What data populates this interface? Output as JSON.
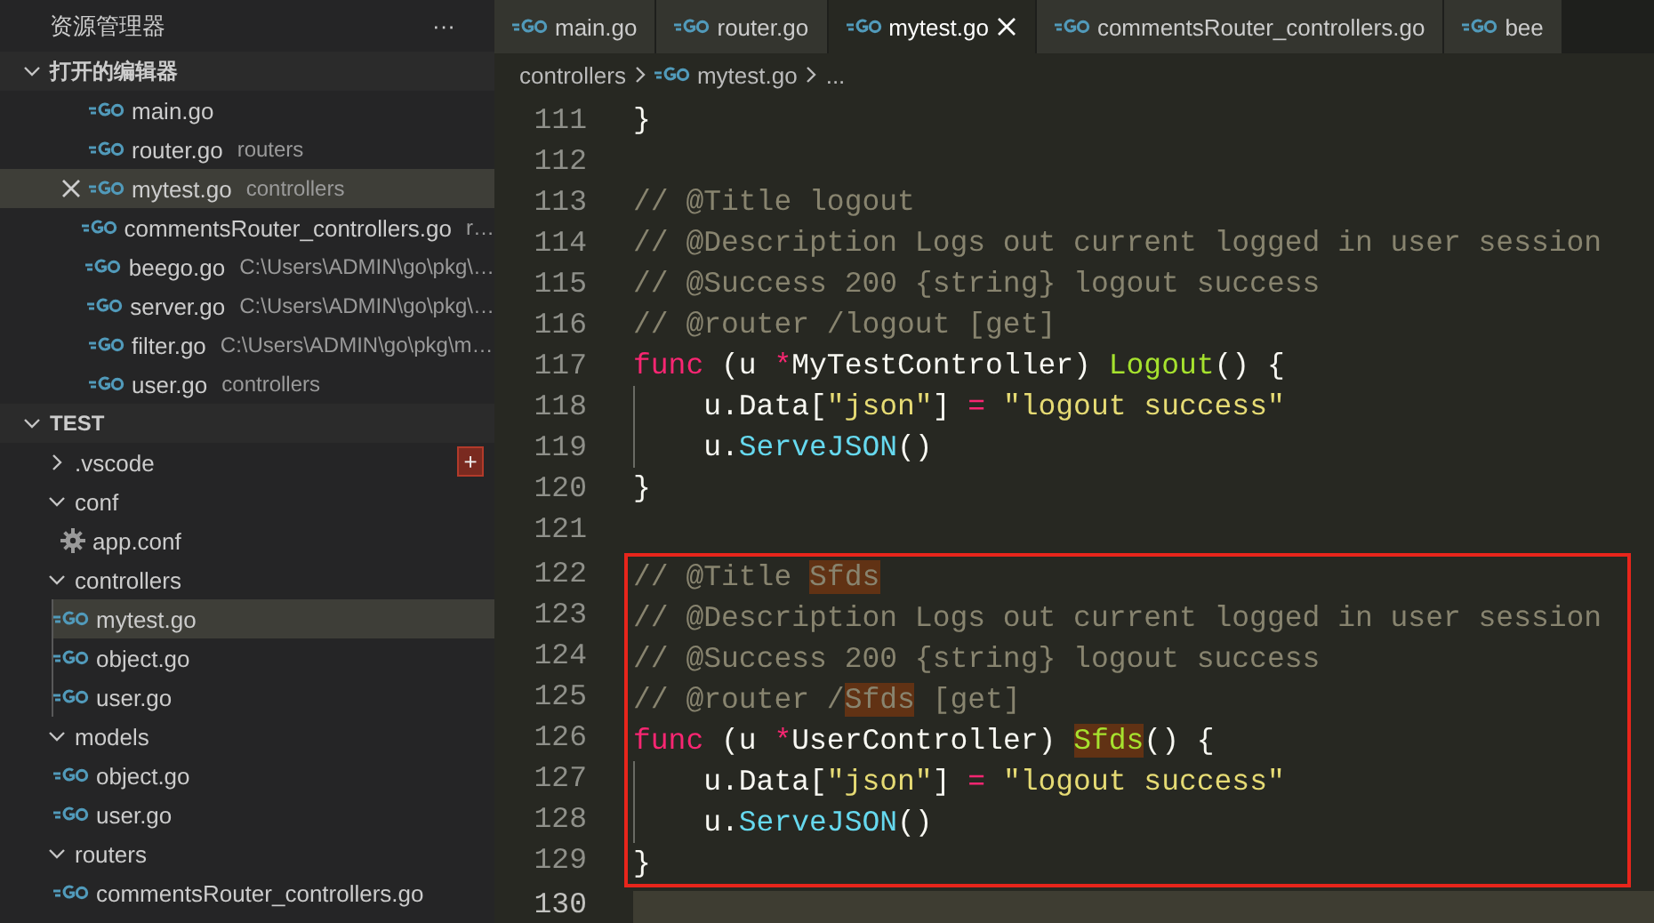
{
  "sidebar": {
    "title": "资源管理器",
    "more": "···",
    "open_editors": {
      "title": "打开的编辑器",
      "expanded": true,
      "items": [
        {
          "name": "main.go",
          "selected": false
        },
        {
          "name": "router.go",
          "detail": "routers",
          "selected": false
        },
        {
          "name": "mytest.go",
          "detail": "controllers",
          "selected": true
        },
        {
          "name": "commentsRouter_controllers.go",
          "detail": "r…",
          "selected": false
        },
        {
          "name": "beego.go",
          "detail": "C:\\Users\\ADMIN\\go\\pkg\\…",
          "selected": false
        },
        {
          "name": "server.go",
          "detail": "C:\\Users\\ADMIN\\go\\pkg\\…",
          "selected": false
        },
        {
          "name": "filter.go",
          "detail": "C:\\Users\\ADMIN\\go\\pkg\\m…",
          "selected": false
        },
        {
          "name": "user.go",
          "detail": "controllers",
          "selected": false
        }
      ]
    },
    "explorer": {
      "title": "TEST",
      "expanded": true,
      "children": [
        {
          "name": ".vscode",
          "kind": "folder",
          "expanded": false,
          "selected": false,
          "action_button": "+"
        },
        {
          "name": "conf",
          "kind": "folder",
          "expanded": true,
          "selected": false,
          "children": [
            {
              "name": "app.conf",
              "kind": "config-file",
              "selected": false
            }
          ]
        },
        {
          "name": "controllers",
          "kind": "folder",
          "expanded": true,
          "selected": false,
          "children": [
            {
              "name": "mytest.go",
              "kind": "go-file",
              "selected": true
            },
            {
              "name": "object.go",
              "kind": "go-file",
              "selected": false
            },
            {
              "name": "user.go",
              "kind": "go-file",
              "selected": false
            }
          ]
        },
        {
          "name": "models",
          "kind": "folder",
          "expanded": true,
          "selected": false,
          "children": [
            {
              "name": "object.go",
              "kind": "go-file",
              "selected": false
            },
            {
              "name": "user.go",
              "kind": "go-file",
              "selected": false
            }
          ]
        },
        {
          "name": "routers",
          "kind": "folder",
          "expanded": true,
          "selected": false,
          "children": [
            {
              "name": "commentsRouter_controllers.go",
              "kind": "go-file",
              "selected": false
            }
          ]
        }
      ]
    }
  },
  "tabs": [
    {
      "label": "main.go",
      "selected": false
    },
    {
      "label": "router.go",
      "selected": false
    },
    {
      "label": "mytest.go",
      "selected": true
    },
    {
      "label": "commentsRouter_controllers.go",
      "selected": false
    },
    {
      "label": "bee",
      "selected": false
    }
  ],
  "breadcrumbs": [
    {
      "kind": "folder",
      "text": "controllers"
    },
    {
      "kind": "go-file",
      "text": "mytest.go"
    },
    {
      "kind": "more",
      "text": "..."
    }
  ],
  "editor": {
    "blocks": [
      {
        "boxed": false,
        "lines": [
          {
            "number": "111",
            "current": false,
            "indent": false,
            "tokens": [
              {
                "text": "}",
                "kind": "plain",
                "match": false
              }
            ]
          },
          {
            "number": "112",
            "current": false,
            "indent": false
          },
          {
            "number": "113",
            "current": false,
            "indent": false,
            "tokens": [
              {
                "text": "// @Title logout",
                "kind": "comment",
                "match": false
              }
            ]
          },
          {
            "number": "114",
            "current": false,
            "indent": false,
            "tokens": [
              {
                "text": "// @Description Logs out current logged in user session",
                "kind": "comment",
                "match": false
              }
            ]
          },
          {
            "number": "115",
            "current": false,
            "indent": false,
            "tokens": [
              {
                "text": "// @Success 200 {string} logout success",
                "kind": "comment",
                "match": false
              }
            ]
          },
          {
            "number": "116",
            "current": false,
            "indent": false,
            "tokens": [
              {
                "text": "// @router /logout [get]",
                "kind": "comment",
                "match": false
              }
            ]
          },
          {
            "number": "117",
            "current": false,
            "indent": false,
            "tokens": [
              {
                "text": "func",
                "kind": "keyword",
                "match": false
              },
              {
                "text": " (u ",
                "kind": "plain",
                "match": false
              },
              {
                "text": "*",
                "kind": "operator",
                "match": false
              },
              {
                "text": "MyTestController) ",
                "kind": "plain",
                "match": false
              },
              {
                "text": "Logout",
                "kind": "function",
                "match": false
              },
              {
                "text": "() {",
                "kind": "plain",
                "match": false
              }
            ]
          },
          {
            "number": "118",
            "current": false,
            "indent": true,
            "tokens": [
              {
                "text": "u.Data[",
                "kind": "plain",
                "match": false
              },
              {
                "text": "\"json\"",
                "kind": "string",
                "match": false
              },
              {
                "text": "] ",
                "kind": "plain",
                "match": false
              },
              {
                "text": "=",
                "kind": "operator",
                "match": false
              },
              {
                "text": " \"logout success\"",
                "kind": "string",
                "match": false
              }
            ]
          },
          {
            "number": "119",
            "current": false,
            "indent": true,
            "tokens": [
              {
                "text": "u.",
                "kind": "plain",
                "match": false
              },
              {
                "text": "ServeJSON",
                "kind": "method",
                "match": false
              },
              {
                "text": "()",
                "kind": "plain",
                "match": false
              }
            ]
          },
          {
            "number": "120",
            "current": false,
            "indent": false,
            "tokens": [
              {
                "text": "}",
                "kind": "plain",
                "match": false
              }
            ]
          },
          {
            "number": "121",
            "current": false,
            "indent": false
          }
        ]
      },
      {
        "boxed": true,
        "lines": [
          {
            "number": "122",
            "current": false,
            "indent": false,
            "tokens": [
              {
                "text": "// @Title ",
                "kind": "comment",
                "match": false
              },
              {
                "text": "Sfds",
                "kind": "comment",
                "match": true
              }
            ]
          },
          {
            "number": "123",
            "current": false,
            "indent": false,
            "tokens": [
              {
                "text": "// @Description Logs out current logged in user session",
                "kind": "comment",
                "match": false
              }
            ]
          },
          {
            "number": "124",
            "current": false,
            "indent": false,
            "tokens": [
              {
                "text": "// @Success 200 {string} logout success",
                "kind": "comment",
                "match": false
              }
            ]
          },
          {
            "number": "125",
            "current": false,
            "indent": false,
            "tokens": [
              {
                "text": "// @router /",
                "kind": "comment",
                "match": false
              },
              {
                "text": "Sfds",
                "kind": "comment",
                "match": true
              },
              {
                "text": " [get]",
                "kind": "comment",
                "match": false
              }
            ]
          },
          {
            "number": "126",
            "current": false,
            "indent": false,
            "tokens": [
              {
                "text": "func",
                "kind": "keyword",
                "match": false
              },
              {
                "text": " (u ",
                "kind": "plain",
                "match": false
              },
              {
                "text": "*",
                "kind": "operator",
                "match": false
              },
              {
                "text": "UserController) ",
                "kind": "plain",
                "match": false
              },
              {
                "text": "Sfds",
                "kind": "function",
                "match": true
              },
              {
                "text": "() {",
                "kind": "plain",
                "match": false
              }
            ]
          },
          {
            "number": "127",
            "current": false,
            "indent": true,
            "tokens": [
              {
                "text": "u.Data[",
                "kind": "plain",
                "match": false
              },
              {
                "text": "\"json\"",
                "kind": "string",
                "match": false
              },
              {
                "text": "] ",
                "kind": "plain",
                "match": false
              },
              {
                "text": "=",
                "kind": "operator",
                "match": false
              },
              {
                "text": " \"logout success\"",
                "kind": "string",
                "match": false
              }
            ]
          },
          {
            "number": "128",
            "current": false,
            "indent": true,
            "tokens": [
              {
                "text": "u.",
                "kind": "plain",
                "match": false
              },
              {
                "text": "ServeJSON",
                "kind": "method",
                "match": false
              },
              {
                "text": "()",
                "kind": "plain",
                "match": false
              }
            ]
          },
          {
            "number": "129",
            "current": false,
            "indent": false,
            "tokens": [
              {
                "text": "}",
                "kind": "plain",
                "match": false
              }
            ]
          }
        ]
      },
      {
        "boxed": false,
        "lines": [
          {
            "number": "130",
            "current": true,
            "indent": false
          }
        ]
      }
    ]
  }
}
